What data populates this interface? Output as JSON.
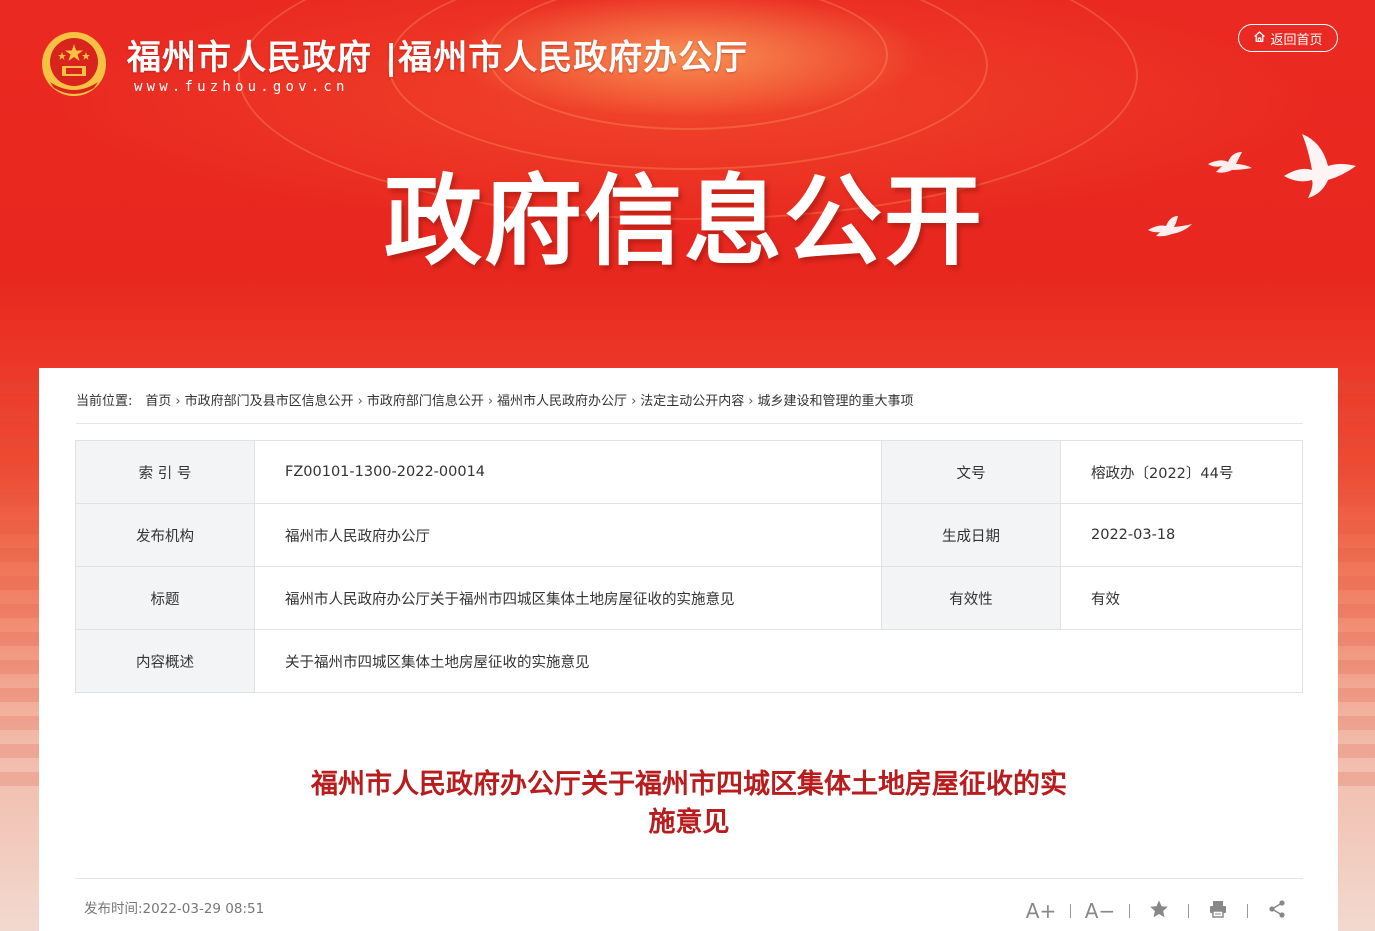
{
  "header": {
    "site_title": "福州市人民政府 |福州市人民政府办公厅",
    "site_url": "www.fuzhou.gov.cn",
    "home_button": "返回首页",
    "page_heading": "政府信息公开"
  },
  "breadcrumb": {
    "lead": "当前位置:",
    "items": [
      "首页",
      "市政府部门及县市区信息公开",
      "市政府部门信息公开",
      "福州市人民政府办公厅",
      "法定主动公开内容",
      "城乡建设和管理的重大事项"
    ]
  },
  "meta": {
    "rows": [
      {
        "k1": "索 引 号",
        "v1": "FZ00101-1300-2022-00014",
        "k2": "文号",
        "v2": "榕政办〔2022〕44号"
      },
      {
        "k1": "发布机构",
        "v1": "福州市人民政府办公厅",
        "k2": "生成日期",
        "v2": "2022-03-18"
      },
      {
        "k1": "标题",
        "v1": "福州市人民政府办公厅关于福州市四城区集体土地房屋征收的实施意见",
        "k2": "有效性",
        "v2": "有效"
      },
      {
        "k1": "内容概述",
        "v1": "关于福州市四城区集体土地房屋征收的实施意见"
      }
    ]
  },
  "document": {
    "title_line1": "福州市人民政府办公厅关于福州市四城区集体土地房屋征收的实",
    "title_line2": "施意见",
    "publish_time": "发布时间:2022-03-29 08:51"
  },
  "tools": {
    "font_larger": "A+",
    "font_smaller": "A−"
  },
  "colors": {
    "banner_red": "#e8281f",
    "title_red": "#b81c1c",
    "key_cell_bg": "#f3f4f6"
  },
  "icons": [
    "national-emblem-icon",
    "home-icon",
    "star-icon",
    "print-icon",
    "share-icon",
    "dove-icon"
  ]
}
